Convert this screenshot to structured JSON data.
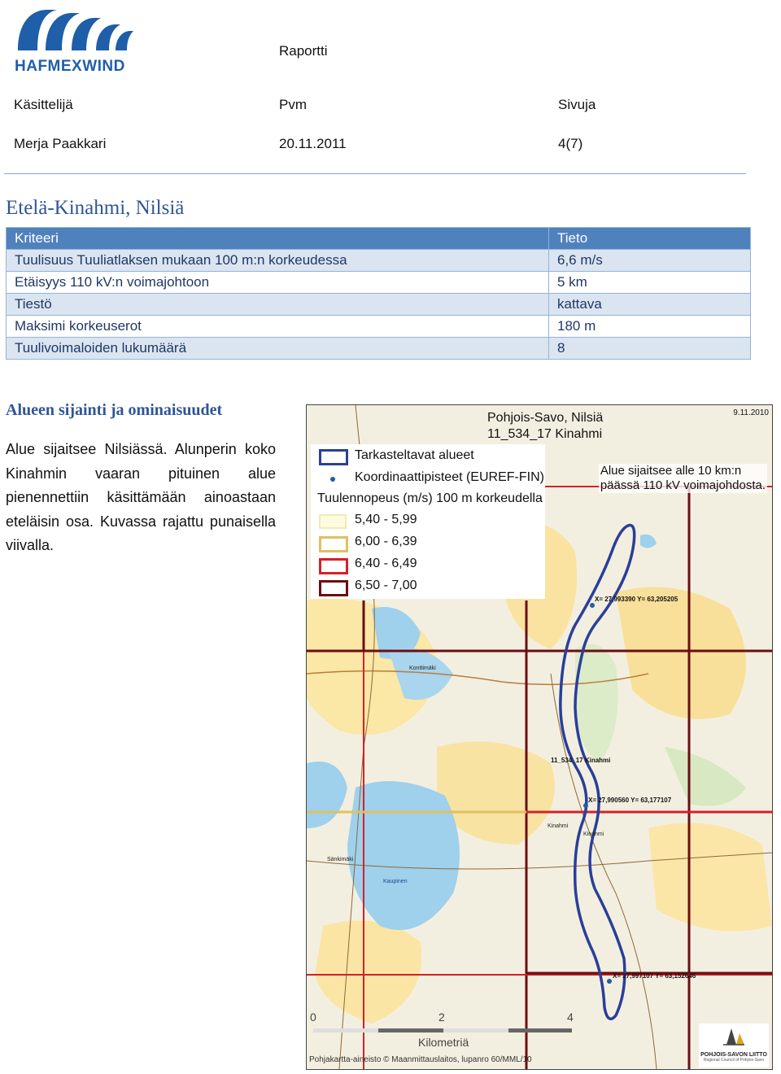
{
  "header": {
    "logo_text": "HAFMEXWIND",
    "report_label": "Raportti",
    "handler_label": "Käsittelijä",
    "handler_value": "Merja Paakkari",
    "date_label": "Pvm",
    "date_value": "20.11.2011",
    "pages_label": "Sivuja",
    "pages_value": "4(7)"
  },
  "title": "Etelä-Kinahmi, Nilsiä",
  "table": {
    "col1": "Kriteeri",
    "col2": "Tieto",
    "rows": [
      {
        "k": "Tuulisuus Tuuliatlaksen mukaan 100 m:n korkeudessa",
        "v": "6,6 m/s"
      },
      {
        "k": "Etäisyys 110 kV:n voimajohtoon",
        "v": "5 km"
      },
      {
        "k": "Tiestö",
        "v": "kattava"
      },
      {
        "k": "Maksimi korkeuserot",
        "v": "180 m"
      },
      {
        "k": "Tuulivoimaloiden lukumäärä",
        "v": "8"
      }
    ]
  },
  "section_title": "Alueen sijainti ja ominaisuudet",
  "paragraph": "Alue sijaitsee Nilsiässä. Alunperin koko Kinahmin vaaran pituinen alue pienennettiin käsittämään ainoastaan eteläisin osa. Kuvassa rajattu punaisella viivalla.",
  "map": {
    "title_line1": "Pohjois-Savo, Nilsiä",
    "title_line2": "11_534_17 Kinahmi",
    "date": "9.11.2010",
    "note_line1": "Alue sijaitsee alle 10 km:n",
    "note_line2": "päässä 110 kV voimajohdosta.",
    "legend": {
      "areas": "Tarkasteltavat alueet",
      "points": "Koordinaattipisteet (EUREF-FIN)",
      "wind_heading": "Tuulennopeus (m/s) 100 m korkeudella",
      "classes": [
        {
          "label": "5,40 - 5,99",
          "color": "#f5f1c8"
        },
        {
          "label": "6,00 - 6,39",
          "color": "#e0c060"
        },
        {
          "label": "6,40 - 6,49",
          "color": "#d4202a"
        },
        {
          "label": "6,50 - 7,00",
          "color": "#6a0e14"
        }
      ]
    },
    "point1": "X= 27,993390   Y= 63,205205",
    "point2": "X= 27,990560   Y= 63,177107",
    "point3": "X= 27,997107   Y= 63,152646",
    "area_label": "11_534_17 Kinahmi",
    "place_konttimaki": "Konttimäki",
    "place_sankimaki": "Sänkimäki",
    "place_kinahmi1": "Kinahmi",
    "place_kinahmi2": "Kinahmi",
    "place_kaupinen": "Kaupinen",
    "scale_0": "0",
    "scale_2": "2",
    "scale_4": "4",
    "scale_unit": "Kilometriä",
    "credit": "Pohjakartta-aineisto © Maanmittauslaitos, lupanro 60/MML/10",
    "org": "POHJOIS-SAVON LIITTO",
    "org_sub": "Regional Council of Pohjois-Savo"
  }
}
